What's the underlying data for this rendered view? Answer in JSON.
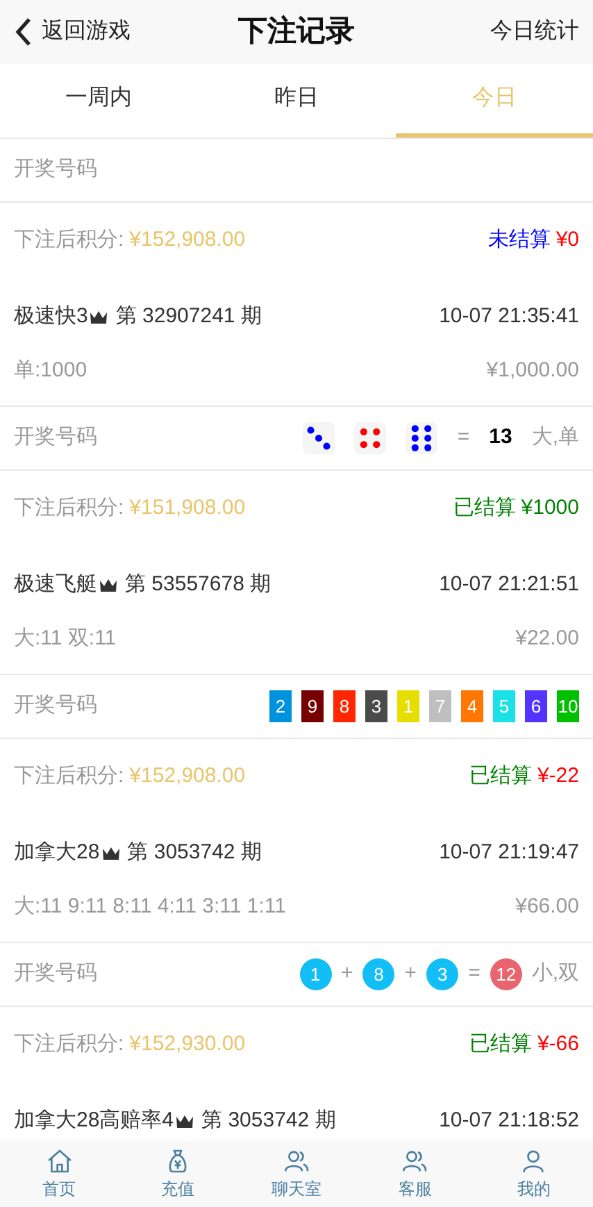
{
  "header": {
    "back": "返回游戏",
    "title": "下注记录",
    "action": "今日统计"
  },
  "tabs": [
    {
      "label": "一周内",
      "selected": false
    },
    {
      "label": "昨日",
      "selected": false
    },
    {
      "label": "今日",
      "selected": true
    }
  ],
  "records": [
    {
      "draw_label": "开奖号码",
      "draw": {
        "kind": "none"
      },
      "balance_label": "下注后积分:",
      "balance": "¥152,908.00",
      "status": {
        "label": "未结算",
        "settled": false
      },
      "amount": {
        "text": "¥0",
        "win": false
      },
      "game": "极速快3",
      "issue": "第 32907241 期",
      "time": "10-07 21:35:41",
      "bet": "单:1000",
      "stake": "¥1,000.00"
    },
    {
      "draw_label": "开奖号码",
      "draw": {
        "kind": "dice",
        "dice": [
          {
            "kind": "three"
          },
          {
            "kind": "four"
          },
          {
            "kind": "six"
          }
        ],
        "equals": "=",
        "total": "13",
        "result": "大,单"
      },
      "balance_label": "下注后积分:",
      "balance": "¥151,908.00",
      "status": {
        "label": "已结算",
        "settled": true
      },
      "amount": {
        "text": "¥1000",
        "win": true
      },
      "game": "极速飞艇",
      "issue": "第 53557678 期",
      "time": "10-07 21:21:51",
      "bet": "大:11 双:11",
      "stake": "¥22.00"
    },
    {
      "draw_label": "开奖号码",
      "draw": {
        "kind": "squares",
        "numbers": [
          {
            "text": "2",
            "color": "#0092dc"
          },
          {
            "text": "9",
            "color": "#760000"
          },
          {
            "text": "8",
            "color": "#ff2600"
          },
          {
            "text": "3",
            "color": "#4b4b4b"
          },
          {
            "text": "1",
            "color": "#e6de00"
          },
          {
            "text": "7",
            "color": "#bfbfbf"
          },
          {
            "text": "4",
            "color": "#ff7600"
          },
          {
            "text": "5",
            "color": "#19e1e6"
          },
          {
            "text": "6",
            "color": "#5234ff"
          },
          {
            "text": "10",
            "color": "#00c000"
          }
        ]
      },
      "balance_label": "下注后积分:",
      "balance": "¥152,908.00",
      "status": {
        "label": "已结算",
        "settled": true
      },
      "amount": {
        "text": "¥-22",
        "win": false
      },
      "game": "加拿大28",
      "issue": "第 3053742 期",
      "time": "10-07 21:19:47",
      "bet": "大:11 9:11 8:11 4:11 3:11 1:11",
      "stake": "¥66.00"
    },
    {
      "draw_label": "开奖号码",
      "draw": {
        "kind": "balls",
        "balls": [
          "1",
          "8",
          "3"
        ],
        "plus": "+",
        "equals": "=",
        "total": "12",
        "result": "小,双"
      },
      "balance_label": "下注后积分:",
      "balance": "¥152,930.00",
      "status": {
        "label": "已结算",
        "settled": true
      },
      "amount": {
        "text": "¥-66",
        "win": false
      },
      "game": "加拿大28高赔率4",
      "issue": "第 3053742 期",
      "time": "10-07 21:18:52"
    }
  ],
  "nav": [
    {
      "label": "首页",
      "kind": "home"
    },
    {
      "label": "充值",
      "kind": "recharge"
    },
    {
      "label": "聊天室",
      "kind": "chat"
    },
    {
      "label": "客服",
      "kind": "support"
    },
    {
      "label": "我的",
      "kind": "profile"
    }
  ]
}
